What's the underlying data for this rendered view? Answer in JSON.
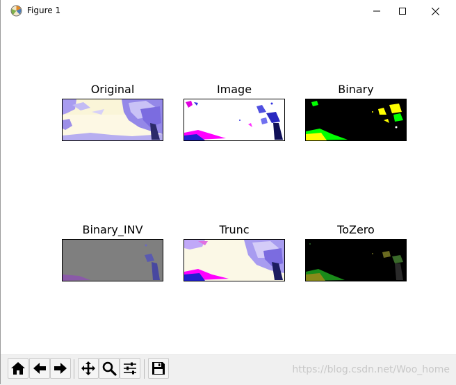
{
  "window": {
    "title": "Figure 1"
  },
  "figure": {
    "panels": [
      {
        "title": "Original"
      },
      {
        "title": "Image"
      },
      {
        "title": "Binary"
      },
      {
        "title": "Binary_INV"
      },
      {
        "title": "Trunc"
      },
      {
        "title": "ToZero"
      }
    ]
  },
  "toolbar": {
    "buttons": [
      {
        "icon": "home-icon"
      },
      {
        "icon": "back-arrow-icon"
      },
      {
        "icon": "forward-arrow-icon"
      },
      {
        "icon": "pan-icon"
      },
      {
        "icon": "zoom-icon"
      },
      {
        "icon": "configure-subplots-icon"
      },
      {
        "icon": "save-icon"
      }
    ],
    "watermark": "https://blog.csdn.net/Woo_home"
  },
  "colors": {
    "panel_original_sky": "#fffbe0",
    "panel_tree_lavender": "#8c7ee6",
    "binary_background": "#000000",
    "binary_inv_gray": "#7f7f7f"
  }
}
